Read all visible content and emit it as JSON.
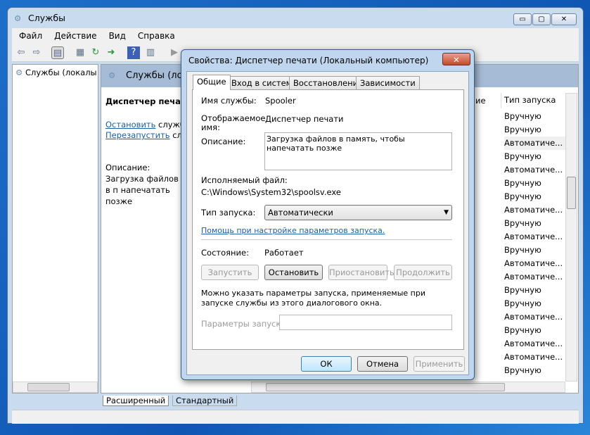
{
  "window": {
    "title": "Службы",
    "minimize": "▭",
    "maximize": "▢",
    "close": "✕"
  },
  "menu": [
    "Файл",
    "Действие",
    "Вид",
    "Справка"
  ],
  "tree": {
    "root": "Службы (локалы"
  },
  "pane": {
    "header": "Службы (лока",
    "service_name": "Диспетчер печати",
    "stop_link": "Остановить",
    "stop_suffix": " службу",
    "restart_link": "Перезапустить",
    "restart_suffix": " служ",
    "desc_label": "Описание:",
    "desc_text": "Загрузка файлов в п напечатать позже"
  },
  "list": {
    "col_partial": "ие",
    "col_startup": "Тип запуска",
    "rows": [
      "Вручную",
      "Вручную",
      "Автоматиче...",
      "Вручную",
      "Автоматиче...",
      "Вручную",
      "Вручную",
      "Автоматиче...",
      "Вручную",
      "Автоматиче...",
      "Вручную",
      "Автоматиче...",
      "Автоматиче...",
      "Вручную",
      "Вручную",
      "Автоматиче...",
      "Вручную",
      "Автоматиче...",
      "Автоматиче...",
      "Вручную"
    ]
  },
  "bottom_tabs": [
    "Расширенный",
    "Стандартный"
  ],
  "dialog": {
    "title": "Свойства: Диспетчер печати (Локальный компьютер)",
    "tabs": [
      "Общие",
      "Вход в систему",
      "Восстановление",
      "Зависимости"
    ],
    "service_name_label": "Имя службы:",
    "service_name": "Spooler",
    "display_name_label": "Отображаемое имя:",
    "display_name": "Диспетчер печати",
    "description_label": "Описание:",
    "description": "Загрузка файлов в память, чтобы напечатать позже",
    "exe_label": "Исполняемый файл:",
    "exe_path": "C:\\Windows\\System32\\spoolsv.exe",
    "startup_label": "Тип запуска:",
    "startup_value": "Автоматически",
    "help_link": "Помощь при настройке параметров запуска.",
    "status_label": "Состояние:",
    "status_value": "Работает",
    "btn_start": "Запустить",
    "btn_stop": "Остановить",
    "btn_pause": "Приостановить",
    "btn_resume": "Продолжить",
    "params_hint": "Можно указать параметры запуска, применяемые при запуске службы из этого диалогового окна.",
    "params_label": "Параметры запуска:",
    "params_value": "",
    "ok": "ОК",
    "cancel": "Отмена",
    "apply": "Применить"
  }
}
